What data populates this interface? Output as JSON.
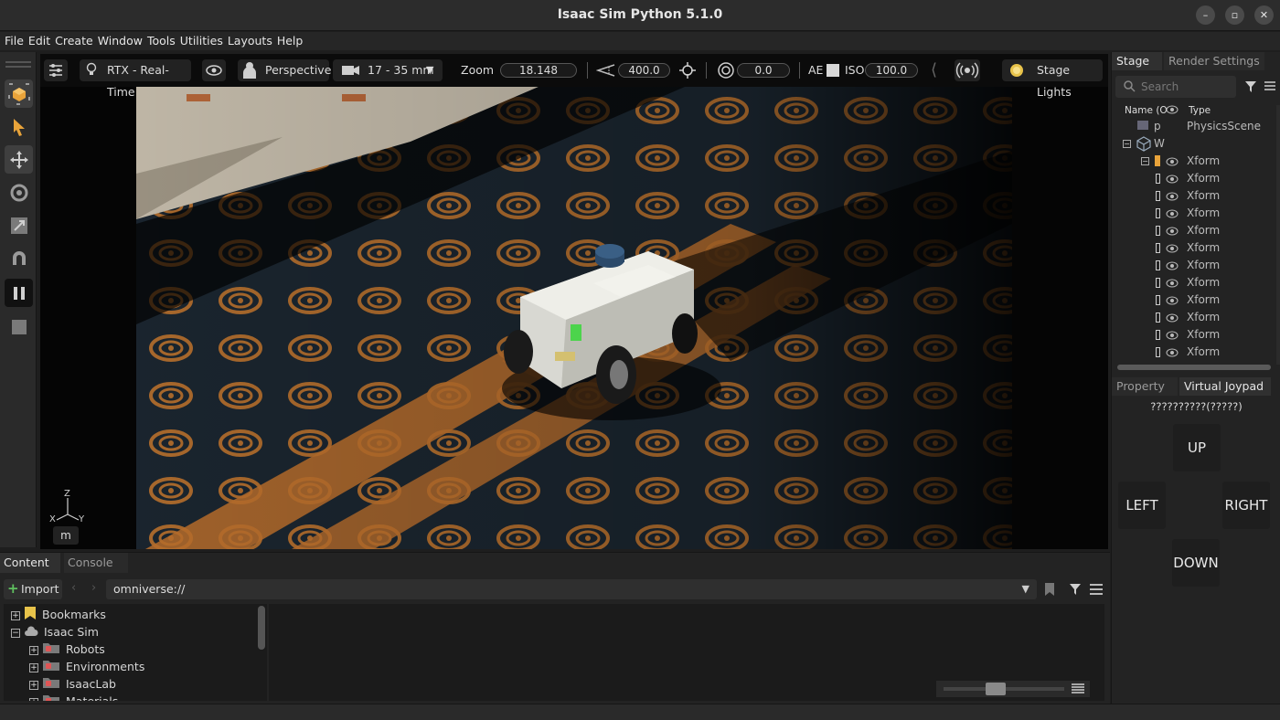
{
  "window": {
    "title": "Isaac Sim Python 5.1.0",
    "minimize_icon": "minimize-icon",
    "restore_icon": "restore-icon",
    "close_icon": "close-icon"
  },
  "menu": [
    "File",
    "Edit",
    "Create",
    "Window",
    "Tools",
    "Utilities",
    "Layouts",
    "Help"
  ],
  "left_tools": [
    "viewport-settings-icon",
    "select-arrow-icon",
    "move-icon",
    "rotate-icon",
    "scale-icon",
    "snap-magnet-icon",
    "pause-icon",
    "stop-icon"
  ],
  "viewport": {
    "renderer": "RTX - Real-Time",
    "camera": "Perspective",
    "lens": "17 - 35 mm",
    "zoom_label": "Zoom",
    "zoom_value": "18.148",
    "fov_value": "400.0",
    "exposure_value": "0.0",
    "ae_label": "AE",
    "iso_label": "ISO",
    "iso_value": "100.0",
    "lights": "Stage Lights",
    "axis_labels": {
      "z": "Z",
      "x": "X",
      "y": "Y"
    },
    "unit": "m"
  },
  "stage": {
    "tabs": [
      "Stage",
      "Render Settings"
    ],
    "search_placeholder": "Search",
    "col_name": "Name (O",
    "col_type": "Type",
    "rows": [
      {
        "name": "p",
        "type": "PhysicsScene"
      },
      {
        "name": "W",
        "type": ""
      },
      {
        "name": "",
        "type": "Xform"
      },
      {
        "name": "",
        "type": "Xform"
      },
      {
        "name": "",
        "type": "Xform"
      },
      {
        "name": "",
        "type": "Xform"
      },
      {
        "name": "",
        "type": "Xform"
      },
      {
        "name": "",
        "type": "Xform"
      },
      {
        "name": "",
        "type": "Xform"
      },
      {
        "name": "",
        "type": "Xform"
      },
      {
        "name": "",
        "type": "Xform"
      },
      {
        "name": "",
        "type": "Xform"
      },
      {
        "name": "",
        "type": "Xform"
      },
      {
        "name": "",
        "type": "Xform"
      }
    ]
  },
  "property": {
    "tabs": [
      "Property",
      "Virtual Joypad"
    ],
    "joypad_title": "??????????(?????)",
    "buttons": {
      "up": "UP",
      "left": "LEFT",
      "right": "RIGHT",
      "down": "DOWN"
    }
  },
  "content": {
    "tabs": [
      "Content",
      "Console"
    ],
    "import_label": "Import",
    "path": "omniverse://",
    "tree": [
      {
        "label": "Bookmarks",
        "level": 0,
        "expand": "+"
      },
      {
        "label": "Isaac Sim",
        "level": 0,
        "expand": "−"
      },
      {
        "label": "Robots",
        "level": 1,
        "expand": "+"
      },
      {
        "label": "Environments",
        "level": 1,
        "expand": "+"
      },
      {
        "label": "IsaacLab",
        "level": 1,
        "expand": "+"
      },
      {
        "label": "Materials",
        "level": 1,
        "expand": "+"
      }
    ]
  },
  "colors": {
    "accent": "#e8a33a",
    "panel": "#232323",
    "carpet": "#1d2a33",
    "swirl": "#c27b35"
  }
}
